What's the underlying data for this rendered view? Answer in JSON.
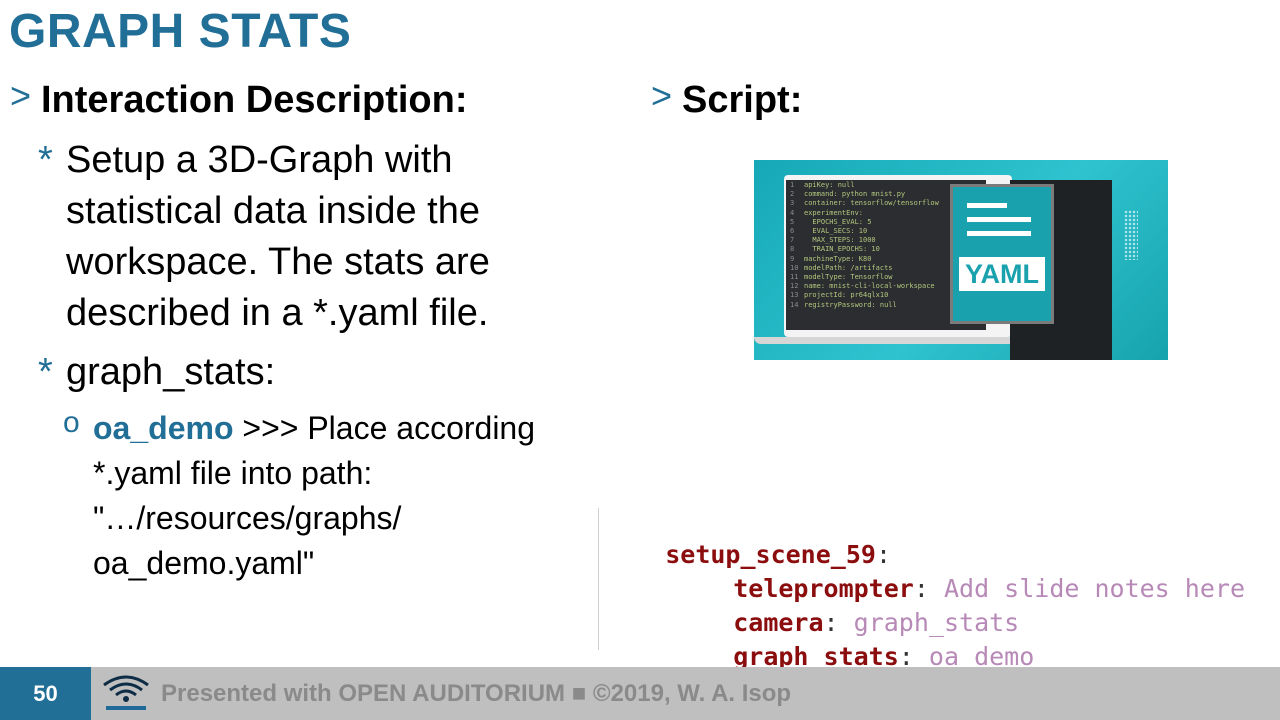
{
  "slide": {
    "title": "GRAPH STATS"
  },
  "left": {
    "heading_marker": ">",
    "heading": "Interaction Description:",
    "bullets": [
      {
        "marker": "*",
        "lines": [
          "Setup a 3D-Graph with",
          "statistical data inside the",
          "workspace. The stats are",
          "described in a *.yaml file."
        ]
      },
      {
        "marker": "*",
        "lines": [
          "graph_stats:"
        ]
      }
    ],
    "sub_bullet": {
      "marker": "o",
      "highlight": "oa_demo",
      "line1_rest": " >>> Place according",
      "lines": [
        "*.yaml file into path:",
        "\"…/resources/graphs/",
        "oa_demo.yaml\""
      ]
    }
  },
  "right": {
    "heading_marker": ">",
    "heading": "Script:",
    "image": {
      "doc_label": "YAML",
      "code_lines": [
        {
          "n": "1",
          "t": "apiKey: null"
        },
        {
          "n": "2",
          "t": "command: python mnist.py"
        },
        {
          "n": "3",
          "t": "container: tensorflow/tensorflow"
        },
        {
          "n": "4",
          "t": "experimentEnv:"
        },
        {
          "n": "5",
          "t": "  EPOCHS_EVAL: 5"
        },
        {
          "n": "6",
          "t": "  EVAL_SECS: 10"
        },
        {
          "n": "7",
          "t": "  MAX_STEPS: 1000"
        },
        {
          "n": "8",
          "t": "  TRAIN_EPOCHS: 10"
        },
        {
          "n": "9",
          "t": "machineType: K80"
        },
        {
          "n": "10",
          "t": "modelPath: /artifacts"
        },
        {
          "n": "11",
          "t": "modelType: Tensorflow"
        },
        {
          "n": "12",
          "t": "name: mnist-cli-local-workspace"
        },
        {
          "n": "13",
          "t": "projectId: pr64qlx10"
        },
        {
          "n": "14",
          "t": "registryPassword: null"
        }
      ]
    },
    "code": {
      "line1_key": "setup_scene_59",
      "line2_key": "teleprompter",
      "line2_val": "Add slide notes here",
      "line3_key": "camera",
      "line3_val": "graph_stats",
      "line4_key": "graph_stats",
      "line4_val": "oa_demo",
      "colon": ":"
    }
  },
  "footer": {
    "page_number": "50",
    "text": "Presented with OPEN AUDITORIUM ■ ©2019, W. A. Isop",
    "logo_icon": "open-auditorium-logo-icon"
  },
  "colors": {
    "accent": "#216e97",
    "footer_bg": "#bfbfbf",
    "code_key": "#8b0d0d",
    "code_value": "#b789b7"
  }
}
